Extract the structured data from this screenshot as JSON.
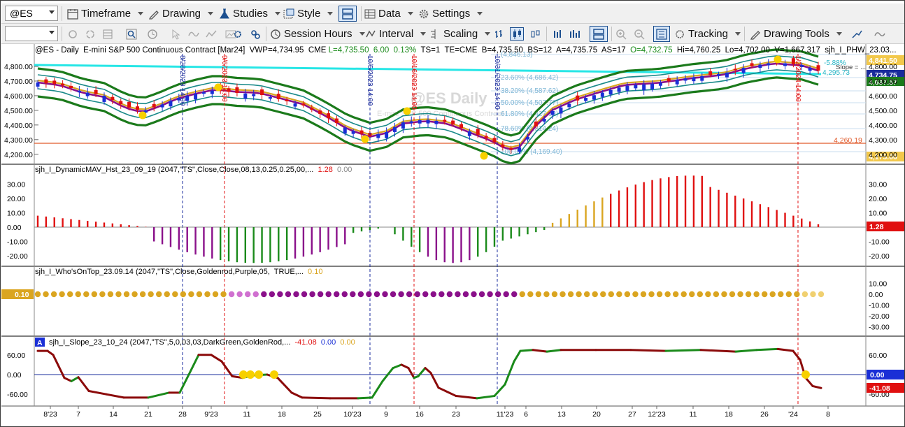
{
  "toolbar1": {
    "symbol": "@ES",
    "timeframe": "Timeframe",
    "drawing": "Drawing",
    "studies": "Studies",
    "style": "Style",
    "data": "Data",
    "settings": "Settings"
  },
  "toolbar2": {
    "session_hours": "Session Hours",
    "interval": "Interval",
    "scaling": "Scaling",
    "tracking": "Tracking",
    "drawing_tools": "Drawing Tools"
  },
  "price_pane": {
    "header": "@ES - Daily  E-mini S&P 500 Continuous Contract [Mar24]  VWP=4,734.95  CME",
    "last": "L=4,735.50",
    "change": "6.00",
    "change_pct": "0.13%",
    "ts": "TS=1  TE=CME  B=4,735.50  BS=12  A=4,735.75  AS=17",
    "open": "O=4,732.75",
    "hilo": "Hi=4,760.25  Lo=4,702.00  V=1,667,317  sjh_I_PHW_23.03...",
    "y_ticks": [
      "4,800.00",
      "4,700.00",
      "4,600.00",
      "4,500.00",
      "4,400.00",
      "4,300.00",
      "4,200.00"
    ],
    "right_labels": {
      "top": "4,841.50",
      "last": "4,734.75",
      "band": "4,697.57",
      "low": "4,175.00",
      "hline": "4,260.19"
    },
    "fib_labels": [
      "(4,846.13)",
      "23.60% (4,686.42)",
      "38.20% (4,587.62)",
      "50.00% (4,507.77)",
      "61.80% (4,427.92)",
      "78.60% (4,314.24)",
      "100.00% (4,169.40)"
    ],
    "side_texts": {
      "slope": "Slope = ...",
      "pct": "-5.88%",
      "rt": "4,295.73"
    },
    "vlines": [
      "8/28/2023 14:00",
      "9/6/2023 14:00",
      "10/5/2023 14:00",
      "10/16/2023 14:00",
      "10/31/2023 14:00",
      "1/2/2024 14:00"
    ],
    "watermark1": "@ES Daily",
    "watermark2": "E-mini S&P 500 Continuous Contract"
  },
  "pane2": {
    "title": "sjh_I_DynamicMAV_Hst_23_09_19 (2047,\"TS\",Close,Close,08,13,0.25,0.25,00,...",
    "v1": "1.28",
    "v2": "0.00",
    "right_value": "1.28",
    "ticks_left": [
      "30.00",
      "20.00",
      "10.00",
      "0.00",
      "-10.00",
      "-20.00"
    ],
    "ticks_right": [
      "30.00",
      "20.00",
      "10.00",
      "0.00",
      "-10.00",
      "-20.00"
    ]
  },
  "pane3": {
    "title": "sjh_I_Who'sOnTop_23.09.14 (2047,\"TS\",Close,Goldenrod,Purple,05,  TRUE,...",
    "v1": "0.10",
    "left_value": "0.10",
    "ticks_right": [
      "10.00",
      "0.00",
      "-10.00",
      "-20.00",
      "-30.00"
    ]
  },
  "pane4": {
    "badge": "A",
    "title": "sjh_I_Slope_23_10_24 (2047,\"TS\",5,0,03,03,DarkGreen,GoldenRod,...",
    "v1": "-41.08",
    "v2": "0.00",
    "v3": "0.00",
    "ticks_left": [
      "60.00",
      "0.00",
      "-60.00"
    ],
    "ticks_right": [
      "60.00",
      "0.00",
      "-60.00"
    ],
    "right_values": [
      "0.00",
      "-41.08"
    ]
  },
  "x_axis": [
    "8'23",
    "7",
    "14",
    "21",
    "28",
    "9'23",
    "11",
    "18",
    "25",
    "10'23",
    "9",
    "16",
    "23",
    "11'23",
    "6",
    "13",
    "20",
    "27",
    "12'23",
    "11",
    "18",
    "26",
    "'24",
    "8"
  ],
  "colors": {
    "up": "#1a2fd6",
    "down": "#e01010",
    "green_band": "#1b7a1b",
    "teal_band": "#1a8a8a",
    "purple": "#8a108a",
    "goldenrod": "#daa520",
    "cyan": "#27e6e6",
    "hline": "#e05a2a",
    "dark_red": "#8b0a0a"
  }
}
